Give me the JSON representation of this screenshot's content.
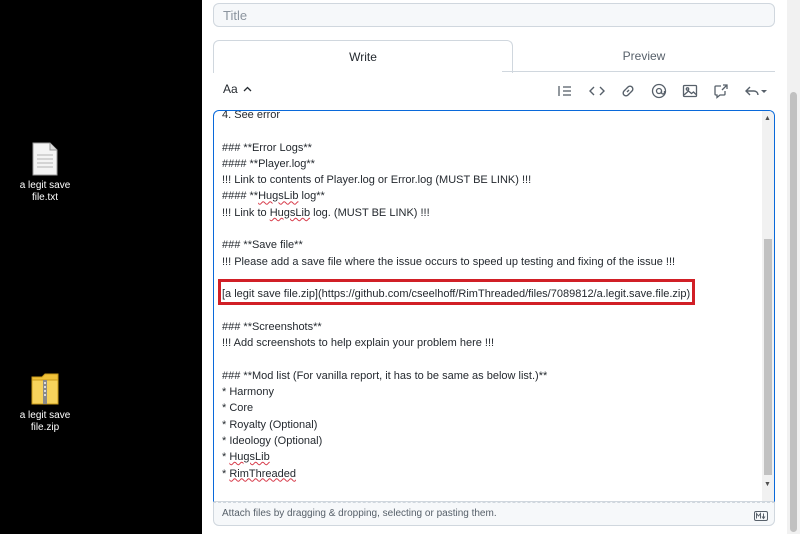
{
  "desktop": {
    "icons": [
      {
        "name": "a legit save file.txt",
        "label_line1": "a legit save",
        "label_line2": "file.txt",
        "icon": "text-file-icon"
      },
      {
        "name": "a legit save file.zip",
        "label_line1": "a legit save",
        "label_line2": "file.zip",
        "icon": "zip-folder-icon"
      }
    ]
  },
  "form": {
    "title_placeholder": "Title",
    "tabs": {
      "write": "Write",
      "preview": "Preview"
    },
    "toolbar": {
      "text_style": "Aa"
    },
    "editor_lines": [
      "4. See error",
      "",
      "### **Error Logs**",
      "#### **Player.log**",
      "!!! Link to contents of Player.log or Error.log (MUST BE LINK) !!!",
      "#### **HugsLib log**",
      "!!! Link to HugsLib log. (MUST BE LINK) !!!",
      "",
      "### **Save file**",
      "!!! Please add a save file where the issue occurs to speed up testing and fixing of the issue !!!",
      "",
      "[a legit save file.zip](https://github.com/cseelhoff/RimThreaded/files/7089812/a.legit.save.file.zip)",
      "",
      "### **Screenshots**",
      "!!! Add screenshots to help explain your problem here !!!",
      "",
      "### **Mod list (For vanilla report, it has to be same as below list.)**",
      "* Harmony",
      "* Core",
      "* Royalty (Optional)",
      "* Ideology (Optional)",
      "* HugsLib",
      "* RimThreaded"
    ],
    "attach_hint": "Attach files by dragging & dropping, selecting or pasting them.",
    "markdown_badge": "M↓"
  },
  "colors": {
    "highlight": "#d11f26",
    "focus": "#0969da"
  }
}
